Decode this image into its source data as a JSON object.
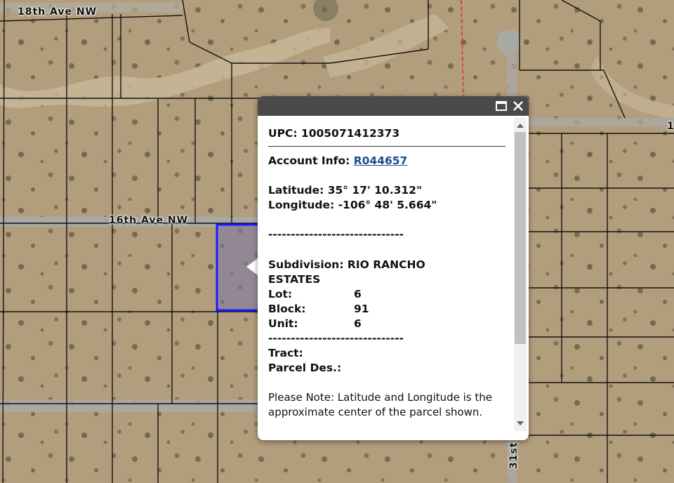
{
  "map": {
    "roads": {
      "road_18th": "18th Ave NW",
      "road_16th": "16th Ave NW",
      "road_31st": "31st",
      "road_edge_1": "1"
    },
    "parcel_color": "#1a1aff"
  },
  "popup": {
    "upc_label": "UPC: 1005071412373",
    "account_label": "Account Info: ",
    "account_link": "R044657",
    "latitude": "Latitude: 35° 17' 10.312\"",
    "longitude": "Longitude: -106° 48' 5.664\"",
    "dashes": "------------------------------",
    "subdivision": "Subdivision: RIO RANCHO ESTATES",
    "lot": {
      "label": "Lot:",
      "value": "6"
    },
    "block": {
      "label": "Block:",
      "value": "91"
    },
    "unit": {
      "label": "Unit:",
      "value": "6"
    },
    "tract": "Tract:",
    "parcel_des": "Parcel Des.:",
    "note": "Please Note: Latitude and Longitude is the approximate center of the parcel shown.",
    "icons": [
      "maximize-icon",
      "close-icon",
      "scroll-up-icon",
      "scroll-down-icon"
    ]
  }
}
